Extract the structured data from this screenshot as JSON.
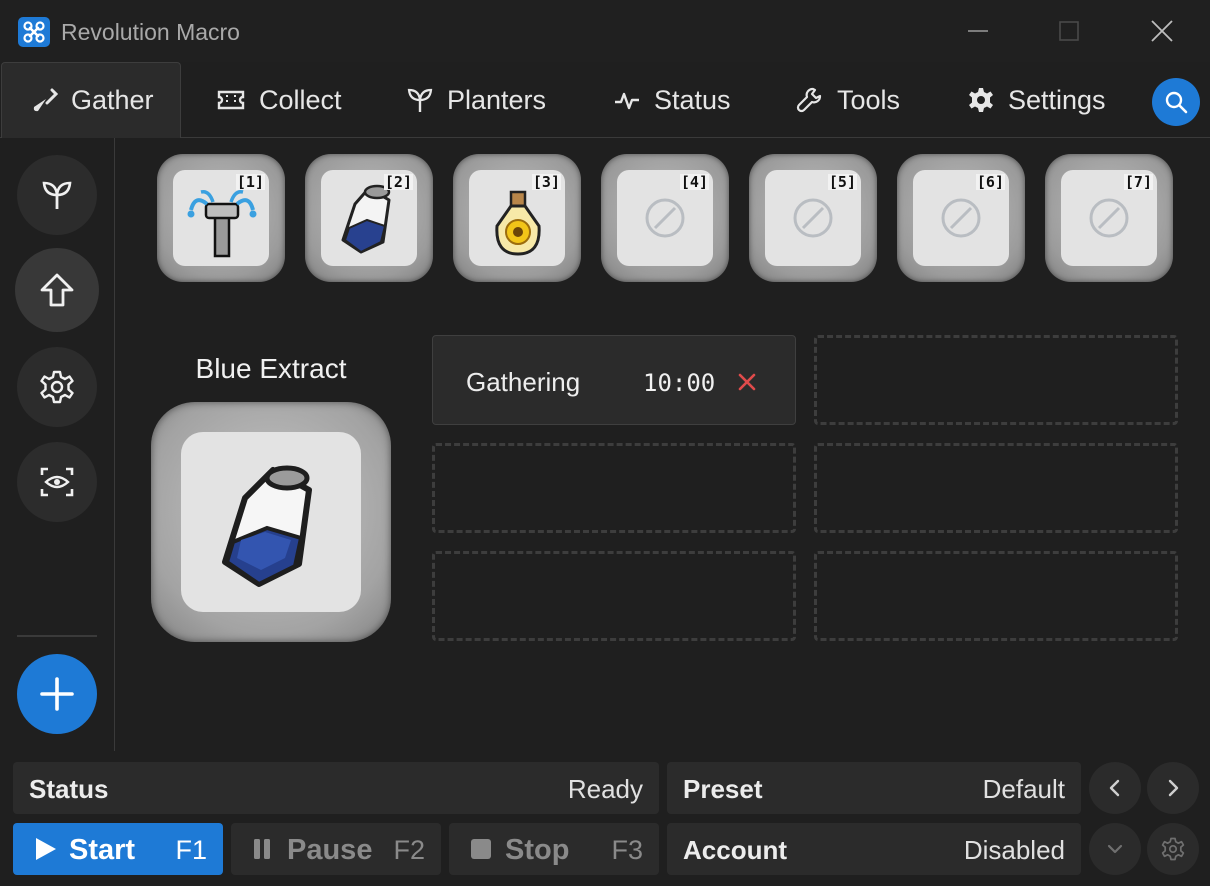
{
  "app": {
    "title": "Revolution Macro"
  },
  "tabs": [
    {
      "label": "Gather",
      "icon": "shovel-icon",
      "active": true
    },
    {
      "label": "Collect",
      "icon": "ticket-icon"
    },
    {
      "label": "Planters",
      "icon": "sprout-icon"
    },
    {
      "label": "Status",
      "icon": "pulse-icon"
    },
    {
      "label": "Tools",
      "icon": "wrench-icon"
    },
    {
      "label": "Settings",
      "icon": "gear-icon"
    }
  ],
  "rail": [
    "sprout-icon",
    "arrow-up-icon",
    "gear-icon",
    "eye-scan-icon",
    "plus-icon"
  ],
  "slots": [
    {
      "number": "[1]",
      "item": "sprinkler-icon"
    },
    {
      "number": "[2]",
      "item": "blue-extract-icon"
    },
    {
      "number": "[3]",
      "item": "sunflower-jar-icon"
    },
    {
      "number": "[4]",
      "item": "empty-slot-icon"
    },
    {
      "number": "[5]",
      "item": "empty-slot-icon"
    },
    {
      "number": "[6]",
      "item": "empty-slot-icon"
    },
    {
      "number": "[7]",
      "item": "empty-slot-icon"
    }
  ],
  "selected": {
    "name": "Blue Extract"
  },
  "tasks": [
    {
      "name": "Gathering",
      "time": "10:00"
    }
  ],
  "bottom": {
    "status_label": "Status",
    "status_value": "Ready",
    "preset_label": "Preset",
    "preset_value": "Default",
    "account_label": "Account",
    "account_value": "Disabled",
    "start": {
      "label": "Start",
      "key": "F1"
    },
    "pause": {
      "label": "Pause",
      "key": "F2"
    },
    "stop": {
      "label": "Stop",
      "key": "F3"
    }
  },
  "colors": {
    "accent": "#1e7ad6",
    "background": "#1f1f1f",
    "panel": "#2b2b2b",
    "remove": "#e04b4b"
  }
}
